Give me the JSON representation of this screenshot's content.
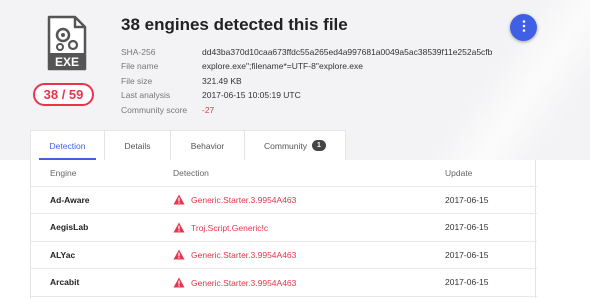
{
  "header": {
    "title": "38 engines detected this file",
    "file_type_label": "EXE",
    "score": {
      "detected": "38",
      "separator": " / ",
      "total": "59"
    },
    "menu_icon": "more-vertical-icon",
    "meta": [
      {
        "label": "SHA-256",
        "value": "dd43ba370d10caa673ffdc55a265ed4a997681a0049a5ac38539f11e252a5cfb"
      },
      {
        "label": "File name",
        "value": "explore.exe\";filename*=UTF-8''explore.exe"
      },
      {
        "label": "File size",
        "value": "321.49 KB"
      },
      {
        "label": "Last analysis",
        "value": "2017-06-15 10:05:19 UTC"
      },
      {
        "label": "Community score",
        "value": "-27"
      }
    ]
  },
  "tabs": [
    {
      "label": "Detection",
      "active": true
    },
    {
      "label": "Details"
    },
    {
      "label": "Behavior"
    },
    {
      "label": "Community",
      "count": "1"
    }
  ],
  "table": {
    "columns": [
      "Engine",
      "Detection",
      "Update"
    ],
    "rows": [
      {
        "engine": "Ad-Aware",
        "detection": "Generic.Starter.3.9954A463",
        "update": "2017-06-15"
      },
      {
        "engine": "AegisLab",
        "detection": "Troj.Script.Generic!c",
        "update": "2017-06-15"
      },
      {
        "engine": "ALYac",
        "detection": "Generic.Starter.3.9954A463",
        "update": "2017-06-15"
      },
      {
        "engine": "Arcabit",
        "detection": "Generic.Starter.3.9954A463",
        "update": "2017-06-15"
      }
    ]
  },
  "colors": {
    "accent": "#3f5fe5",
    "danger": "#e8344e"
  }
}
